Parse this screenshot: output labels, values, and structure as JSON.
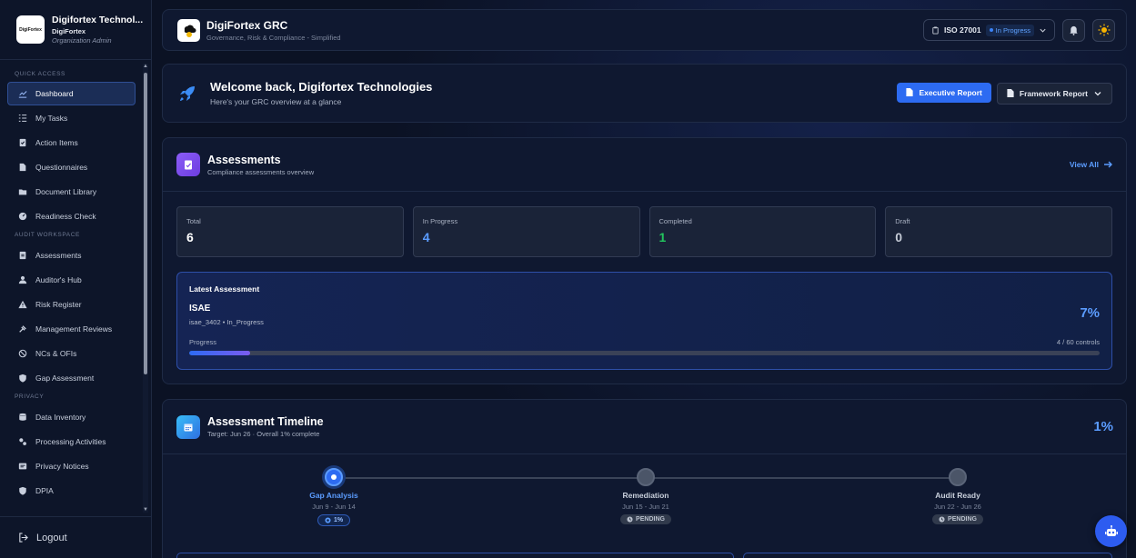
{
  "org": {
    "logo_text": "DigiFortex",
    "name": "Digifortex Technol...",
    "sub": "DigiFortex",
    "role": "Organization Admin"
  },
  "nav": {
    "sections": [
      {
        "title": "QUICK ACCESS",
        "items": [
          {
            "label": "Dashboard",
            "icon": "chart-line-icon",
            "active": true
          },
          {
            "label": "My Tasks",
            "icon": "list-icon"
          },
          {
            "label": "Action Items",
            "icon": "clipboard-check-icon"
          },
          {
            "label": "Questionnaires",
            "icon": "file-icon"
          },
          {
            "label": "Document Library",
            "icon": "folder-icon"
          },
          {
            "label": "Readiness Check",
            "icon": "gauge-icon"
          }
        ]
      },
      {
        "title": "AUDIT WORKSPACE",
        "items": [
          {
            "label": "Assessments",
            "icon": "clipboard-icon"
          },
          {
            "label": "Auditor's Hub",
            "icon": "user-icon"
          },
          {
            "label": "Risk Register",
            "icon": "warning-icon"
          },
          {
            "label": "Management Reviews",
            "icon": "gavel-icon"
          },
          {
            "label": "NCs & OFIs",
            "icon": "ban-icon"
          },
          {
            "label": "Gap Assessment",
            "icon": "shield-icon"
          }
        ]
      },
      {
        "title": "PRIVACY",
        "items": [
          {
            "label": "Data Inventory",
            "icon": "database-icon"
          },
          {
            "label": "Processing Activities",
            "icon": "gears-icon"
          },
          {
            "label": "Privacy Notices",
            "icon": "notice-icon"
          },
          {
            "label": "DPIA",
            "icon": "shield-icon"
          }
        ]
      }
    ],
    "logout": "Logout"
  },
  "topbar": {
    "title": "DigiFortex GRC",
    "subtitle": "Governance, Risk & Compliance - Simplified",
    "framework": "ISO 27001",
    "framework_status": "In Progress"
  },
  "welcome": {
    "title": "Welcome back, Digifortex Technologies",
    "subtitle": "Here's your GRC overview at a glance",
    "exec_report": "Executive Report",
    "framework_report": "Framework Report"
  },
  "assessments": {
    "title": "Assessments",
    "subtitle": "Compliance assessments overview",
    "view_all": "View All",
    "stats": [
      {
        "label": "Total",
        "value": "6",
        "color": "#ffffff"
      },
      {
        "label": "In Progress",
        "value": "4",
        "color": "#5b9cff"
      },
      {
        "label": "Completed",
        "value": "1",
        "color": "#22c55e"
      },
      {
        "label": "Draft",
        "value": "0",
        "color": "#c5cbd6"
      }
    ],
    "latest": {
      "heading": "Latest Assessment",
      "name": "ISAE",
      "meta": "isae_3402 • In_Progress",
      "percent": "7%",
      "progress_label": "Progress",
      "controls": "4 / 60 controls",
      "progress_value": 0.0667
    }
  },
  "timeline": {
    "title": "Assessment Timeline",
    "subtitle": "Target: Jun 26 · Overall 1% complete",
    "percent": "1%",
    "steps": [
      {
        "name": "Gap Analysis",
        "dates": "Jun 9 - Jun 14",
        "badge": "1%",
        "active": true
      },
      {
        "name": "Remediation",
        "dates": "Jun 15 - Jun 21",
        "badge": "PENDING",
        "active": false
      },
      {
        "name": "Audit Ready",
        "dates": "Jun 22 - Jun 26",
        "badge": "PENDING",
        "active": false
      }
    ]
  }
}
